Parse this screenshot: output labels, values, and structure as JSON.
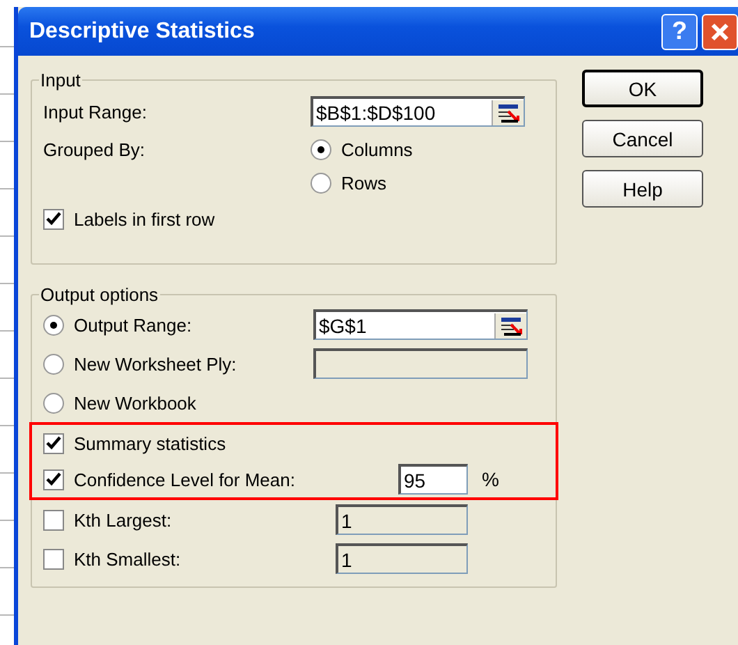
{
  "window": {
    "title": "Descriptive Statistics",
    "help_glyph": "?"
  },
  "input": {
    "legend": "Input",
    "input_range": {
      "label": "Input Range:",
      "value": "$B$1:$D$100"
    },
    "grouped_by": {
      "label": "Grouped By:",
      "options": [
        {
          "label": "Columns",
          "selected": true
        },
        {
          "label": "Rows",
          "selected": false
        }
      ]
    },
    "labels_in_first_row": {
      "label": "Labels in first row",
      "checked": true
    }
  },
  "output": {
    "legend": "Output options",
    "destinations": [
      {
        "label": "Output Range:",
        "selected": true,
        "kind": "range",
        "value": "$G$1"
      },
      {
        "label": "New Worksheet Ply:",
        "selected": false,
        "kind": "text"
      },
      {
        "label": "New Workbook",
        "selected": false,
        "kind": "none"
      }
    ],
    "statistics": [
      {
        "label": "Summary statistics",
        "checked": true,
        "highlighted": true,
        "kind": "plain"
      },
      {
        "label": "Confidence Level for Mean:",
        "checked": true,
        "highlighted": true,
        "kind": "percent",
        "value": "95",
        "unit": "%"
      },
      {
        "label": "Kth Largest:",
        "checked": false,
        "highlighted": false,
        "kind": "number",
        "value": "1"
      },
      {
        "label": "Kth Smallest:",
        "checked": false,
        "highlighted": false,
        "kind": "number",
        "value": "1"
      }
    ]
  },
  "buttons": [
    "OK",
    "Cancel",
    "Help"
  ]
}
